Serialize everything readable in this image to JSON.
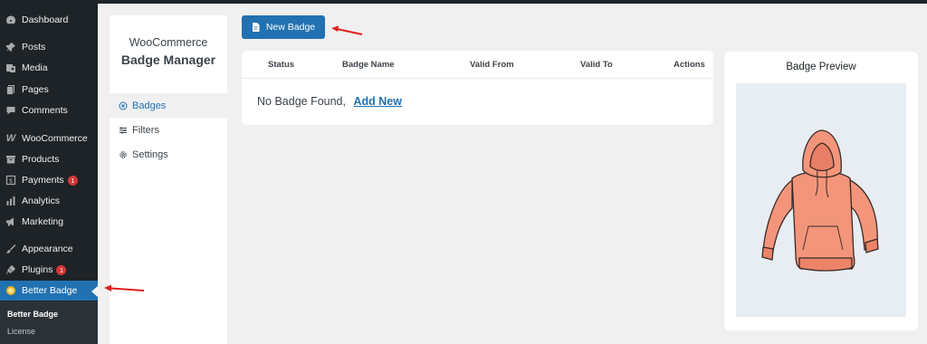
{
  "wp_menu": [
    {
      "label": "Dashboard",
      "icon": "dashboard-icon"
    },
    {
      "label": "Posts",
      "icon": "pin-icon"
    },
    {
      "label": "Media",
      "icon": "media-icon"
    },
    {
      "label": "Pages",
      "icon": "pages-icon"
    },
    {
      "label": "Comments",
      "icon": "comment-icon"
    },
    {
      "label": "WooCommerce",
      "icon": "woo-icon"
    },
    {
      "label": "Products",
      "icon": "products-icon"
    },
    {
      "label": "Payments",
      "icon": "payments-icon",
      "badge": "1"
    },
    {
      "label": "Analytics",
      "icon": "analytics-icon"
    },
    {
      "label": "Marketing",
      "icon": "megaphone-icon"
    },
    {
      "label": "Appearance",
      "icon": "brush-icon"
    },
    {
      "label": "Plugins",
      "icon": "plug-icon",
      "badge": "1"
    },
    {
      "label": "Better Badge",
      "icon": "medal-icon"
    }
  ],
  "wp_submenu": [
    "Better Badge",
    "License"
  ],
  "plugin": {
    "brand_line1": "WooCommerce",
    "brand_line2": "Badge Manager",
    "nav": [
      {
        "label": "Badges",
        "icon": "circle-x-icon"
      },
      {
        "label": "Filters",
        "icon": "sliders-icon"
      },
      {
        "label": "Settings",
        "icon": "gear-icon"
      }
    ]
  },
  "new_badge_button": "New Badge",
  "table": {
    "columns": [
      "Status",
      "Badge Name",
      "Valid From",
      "Valid To",
      "Actions"
    ],
    "empty_text": "No Badge Found,",
    "add_new_link": "Add New"
  },
  "preview": {
    "title": "Badge Preview"
  },
  "colors": {
    "accent": "#2271b1",
    "sidebar": "#1d2327",
    "badge_red": "#d63638",
    "arrow_red": "#e0201e"
  }
}
